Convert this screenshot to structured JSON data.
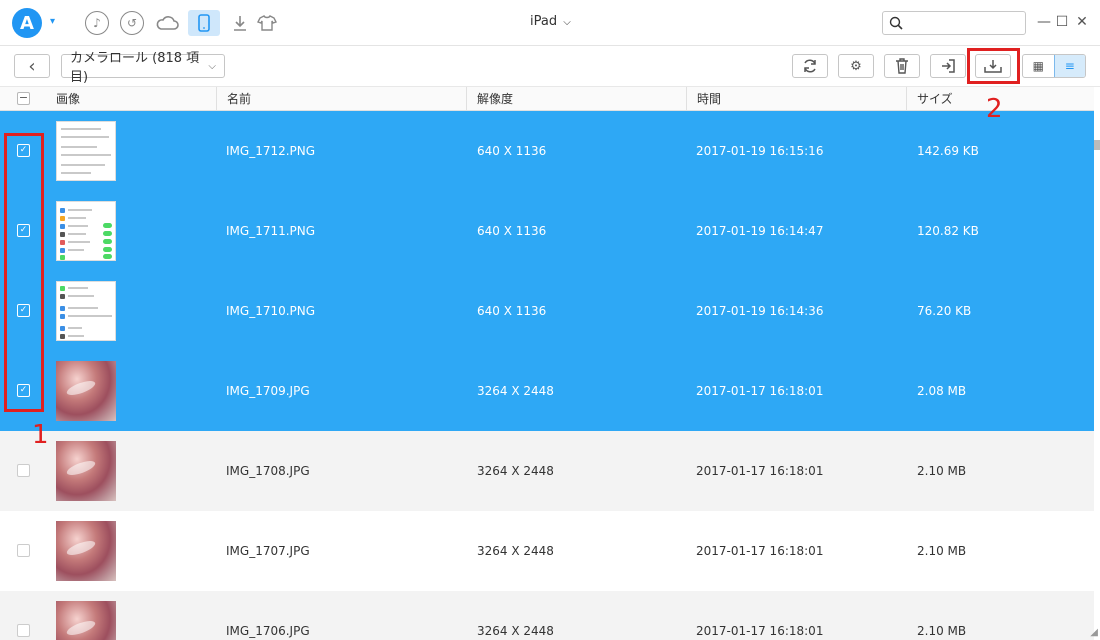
{
  "titlebar": {
    "logo_letter": "A",
    "device_name": "iPad",
    "device_caret": "⌵",
    "search": {
      "placeholder": "",
      "value": ""
    },
    "nav_icons": [
      "music-icon",
      "history-icon",
      "cloud-icon",
      "device-icon",
      "download-icon",
      "shirt-icon"
    ],
    "window_controls": [
      "minimize-icon",
      "maximize-icon",
      "close-icon"
    ]
  },
  "toolbar": {
    "back_glyph": "‹",
    "album_label": "カメラロール (818 項目)",
    "album_caret": "⌵",
    "right_buttons": [
      "refresh-icon",
      "settings-icon",
      "delete-icon",
      "import-icon",
      "export-to-computer-icon"
    ],
    "view_modes": [
      "grid-view-icon",
      "list-view-icon"
    ],
    "active_view": "list"
  },
  "table": {
    "columns": [
      "画像",
      "名前",
      "解像度",
      "時間",
      "サイズ"
    ],
    "rows": [
      {
        "selected": true,
        "thumb": "screenshot-settings",
        "name": "IMG_1712.PNG",
        "resolution": "640 X 1136",
        "time": "2017-01-19 16:15:16",
        "size": "142.69 KB"
      },
      {
        "selected": true,
        "thumb": "screenshot-toggles",
        "name": "IMG_1711.PNG",
        "resolution": "640 X 1136",
        "time": "2017-01-19 16:14:47",
        "size": "120.82 KB"
      },
      {
        "selected": true,
        "thumb": "screenshot-list",
        "name": "IMG_1710.PNG",
        "resolution": "640 X 1136",
        "time": "2017-01-19 16:14:36",
        "size": "76.20 KB"
      },
      {
        "selected": true,
        "thumb": "photo",
        "name": "IMG_1709.JPG",
        "resolution": "3264 X 2448",
        "time": "2017-01-17 16:18:01",
        "size": "2.08 MB"
      },
      {
        "selected": false,
        "thumb": "photo",
        "name": "IMG_1708.JPG",
        "resolution": "3264 X 2448",
        "time": "2017-01-17 16:18:01",
        "size": "2.10 MB"
      },
      {
        "selected": false,
        "thumb": "photo",
        "name": "IMG_1707.JPG",
        "resolution": "3264 X 2448",
        "time": "2017-01-17 16:18:01",
        "size": "2.10 MB"
      },
      {
        "selected": false,
        "thumb": "photo",
        "name": "IMG_1706.JPG",
        "resolution": "3264 X 2448",
        "time": "2017-01-17 16:18:01",
        "size": "2.10 MB"
      }
    ]
  },
  "annotations": {
    "step1": "1",
    "step2": "2"
  },
  "colors": {
    "accent": "#2196f3",
    "selection": "#2ea8f5",
    "annotation": "#e02020"
  }
}
